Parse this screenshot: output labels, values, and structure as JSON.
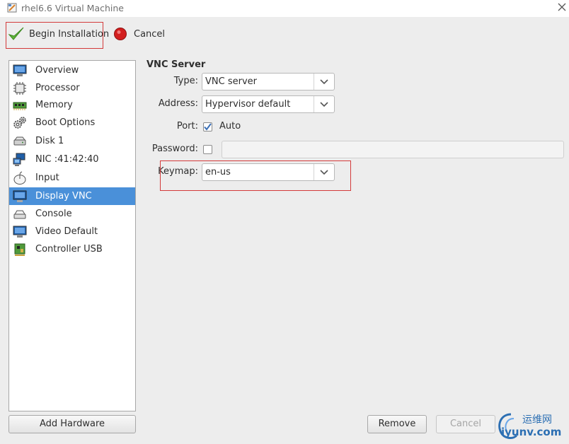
{
  "window": {
    "title": "rhel6.6 Virtual Machine"
  },
  "toolbar": {
    "begin_label": "Begin Installation",
    "cancel_label": "Cancel"
  },
  "sidebar": {
    "items": [
      {
        "label": "Overview",
        "icon": "monitor-icon"
      },
      {
        "label": "Processor",
        "icon": "cpu-icon"
      },
      {
        "label": "Memory",
        "icon": "memory-icon"
      },
      {
        "label": "Boot Options",
        "icon": "gears-icon"
      },
      {
        "label": "Disk 1",
        "icon": "disk-icon"
      },
      {
        "label": "NIC :41:42:40",
        "icon": "network-icon"
      },
      {
        "label": "Input",
        "icon": "mouse-icon"
      },
      {
        "label": "Display VNC",
        "icon": "display-icon",
        "selected": true
      },
      {
        "label": "Console",
        "icon": "console-icon"
      },
      {
        "label": "Video Default",
        "icon": "video-icon"
      },
      {
        "label": "Controller USB",
        "icon": "usb-controller-icon"
      }
    ],
    "add_hardware_label": "Add Hardware"
  },
  "vnc": {
    "section_title": "VNC Server",
    "type_label": "Type:",
    "type_value": "VNC server",
    "address_label": "Address:",
    "address_value": "Hypervisor default",
    "port_label": "Port:",
    "port_auto_label": "Auto",
    "port_auto_checked": true,
    "password_label": "Password:",
    "password_checked": false,
    "password_value": "",
    "keymap_label": "Keymap:",
    "keymap_value": "en-us"
  },
  "footer": {
    "remove_label": "Remove",
    "cancel_label": "Cancel"
  },
  "watermark": {
    "line1": "运维网",
    "line2": "iyunv.com"
  },
  "colors": {
    "selection": "#4a90d9",
    "annotation_box": "#d33a3a",
    "watermark": "#2c6fb3"
  }
}
